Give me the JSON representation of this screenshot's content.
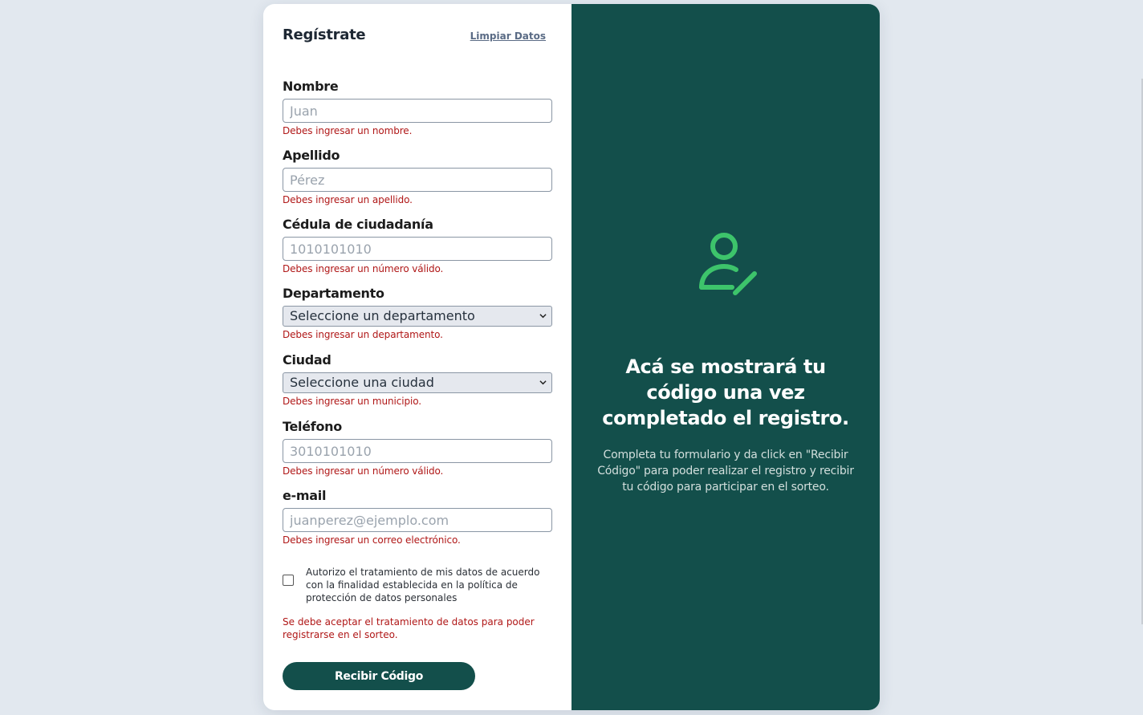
{
  "form": {
    "title": "Regístrate",
    "clear_label": "Limpiar Datos",
    "fields": {
      "nombre": {
        "label": "Nombre",
        "placeholder": "Juan",
        "error": "Debes ingresar un nombre."
      },
      "apellido": {
        "label": "Apellido",
        "placeholder": "Pérez",
        "error": "Debes ingresar un apellido."
      },
      "cedula": {
        "label": "Cédula de ciudadanía",
        "placeholder": "1010101010",
        "error": "Debes ingresar un número válido."
      },
      "departamento": {
        "label": "Departamento",
        "selected": "Seleccione un departamento",
        "error": "Debes ingresar un departamento."
      },
      "ciudad": {
        "label": "Ciudad",
        "selected": "Seleccione una ciudad",
        "error": "Debes ingresar un municipio."
      },
      "telefono": {
        "label": "Teléfono",
        "placeholder": "3010101010",
        "error": "Debes ingresar un número válido."
      },
      "email": {
        "label": "e-mail",
        "placeholder": "juanperez@ejemplo.com",
        "error": "Debes ingresar un correo electrónico."
      }
    },
    "consent": {
      "checked": false,
      "text": "Autorizo el tratamiento de mis datos de acuerdo con la finalidad establecida en la política de protección de datos personales",
      "error": "Se debe aceptar el tratamiento de datos para poder registrarse en el sorteo."
    },
    "submit_label": "Recibir Código"
  },
  "info": {
    "icon": "user-edit-icon",
    "title": "Acá se mostrará tu código una vez completado el registro.",
    "text": "Completa tu formulario y da click en \"Recibir Código\" para poder realizar el registro y recibir tu código para participar en el sorteo."
  },
  "colors": {
    "background": "#e2e8ef",
    "panel_green": "#134f4b",
    "icon_green": "#3dc46b",
    "error_red": "#b01717",
    "button_green": "#134f4b"
  }
}
